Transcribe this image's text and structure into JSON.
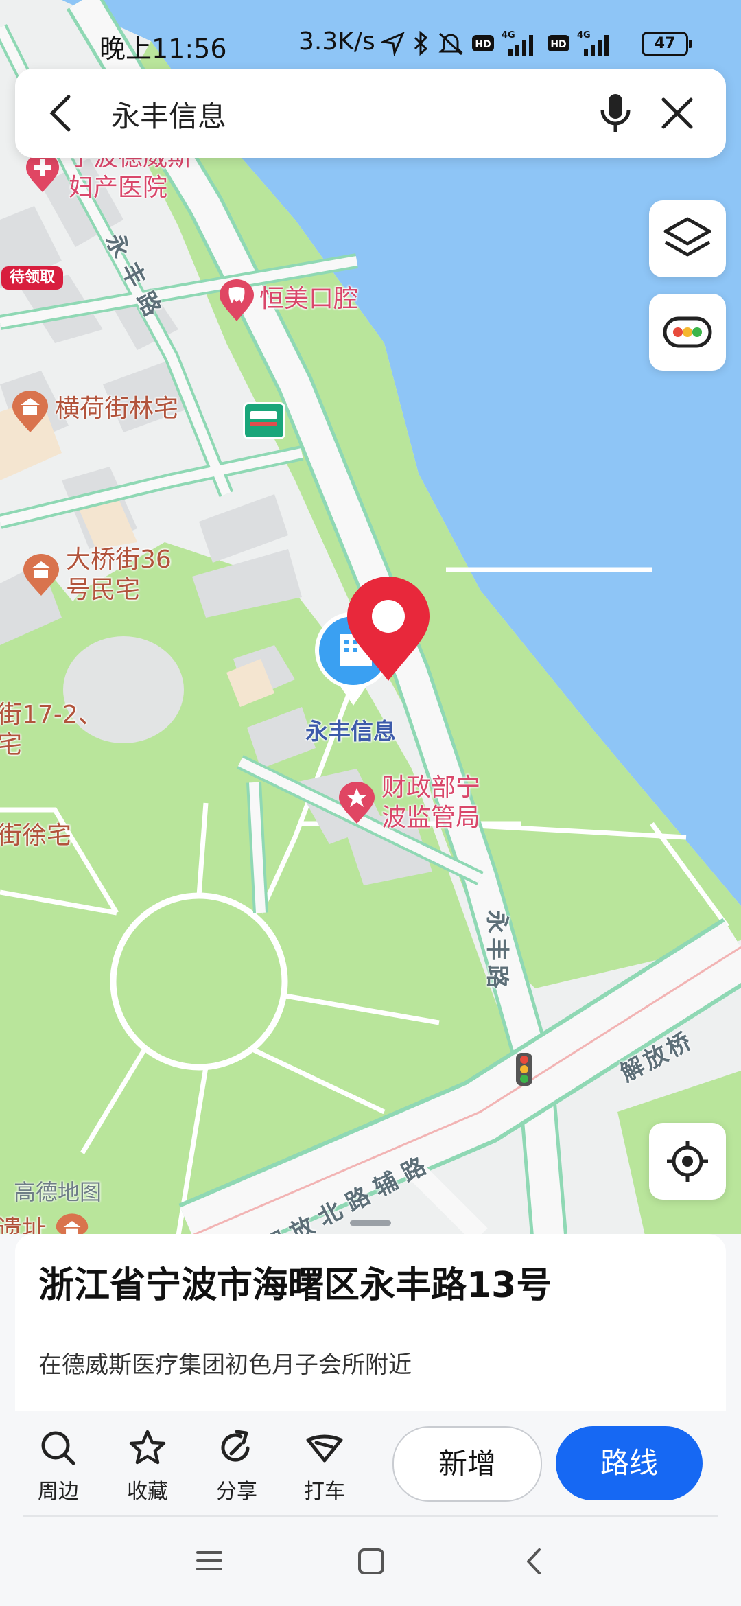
{
  "status_bar": {
    "time": "晚上11:56",
    "speed": "3.3K/s",
    "battery": "47"
  },
  "search": {
    "query": "永丰信息"
  },
  "map": {
    "attribution": "高德地图",
    "badge_pending": "待领取",
    "pois": [
      {
        "name": "宁波德威斯妇产医院",
        "line1": "宁波德威斯",
        "line2": "妇产医院",
        "icon": "hospital-icon"
      },
      {
        "name": "恒美口腔",
        "icon": "dental-icon"
      },
      {
        "name": "横荷街林宅",
        "icon": "landmark-icon"
      },
      {
        "name": "大桥街36号民宅",
        "line1": "大桥街36",
        "line2": "号民宅",
        "icon": "landmark-icon"
      },
      {
        "name": "街17-2、宅",
        "line1": "街17-2、",
        "line2": "宅"
      },
      {
        "name": "街徐宅"
      },
      {
        "name": "财政部宁波监管局",
        "line1": "财政部宁",
        "line2": "波监管局",
        "icon": "government-icon"
      },
      {
        "name": "遗址",
        "line1": "遗址"
      }
    ],
    "selected_poi": "永丰信息",
    "roads": [
      "永丰路",
      "永丰路",
      "解放桥",
      "解放北路辅路"
    ]
  },
  "sheet": {
    "address": "浙江省宁波市海曙区永丰路13号",
    "nearby": "在德威斯医疗集团初色月子会所附近"
  },
  "toolbar": {
    "nearby": "周边",
    "favorite": "收藏",
    "share": "分享",
    "taxi": "打车",
    "add": "新增",
    "route": "路线"
  },
  "colors": {
    "water": "#8ec5f6",
    "park": "#b9e59b",
    "accent": "#1668f3",
    "marker": "#e8283b"
  }
}
